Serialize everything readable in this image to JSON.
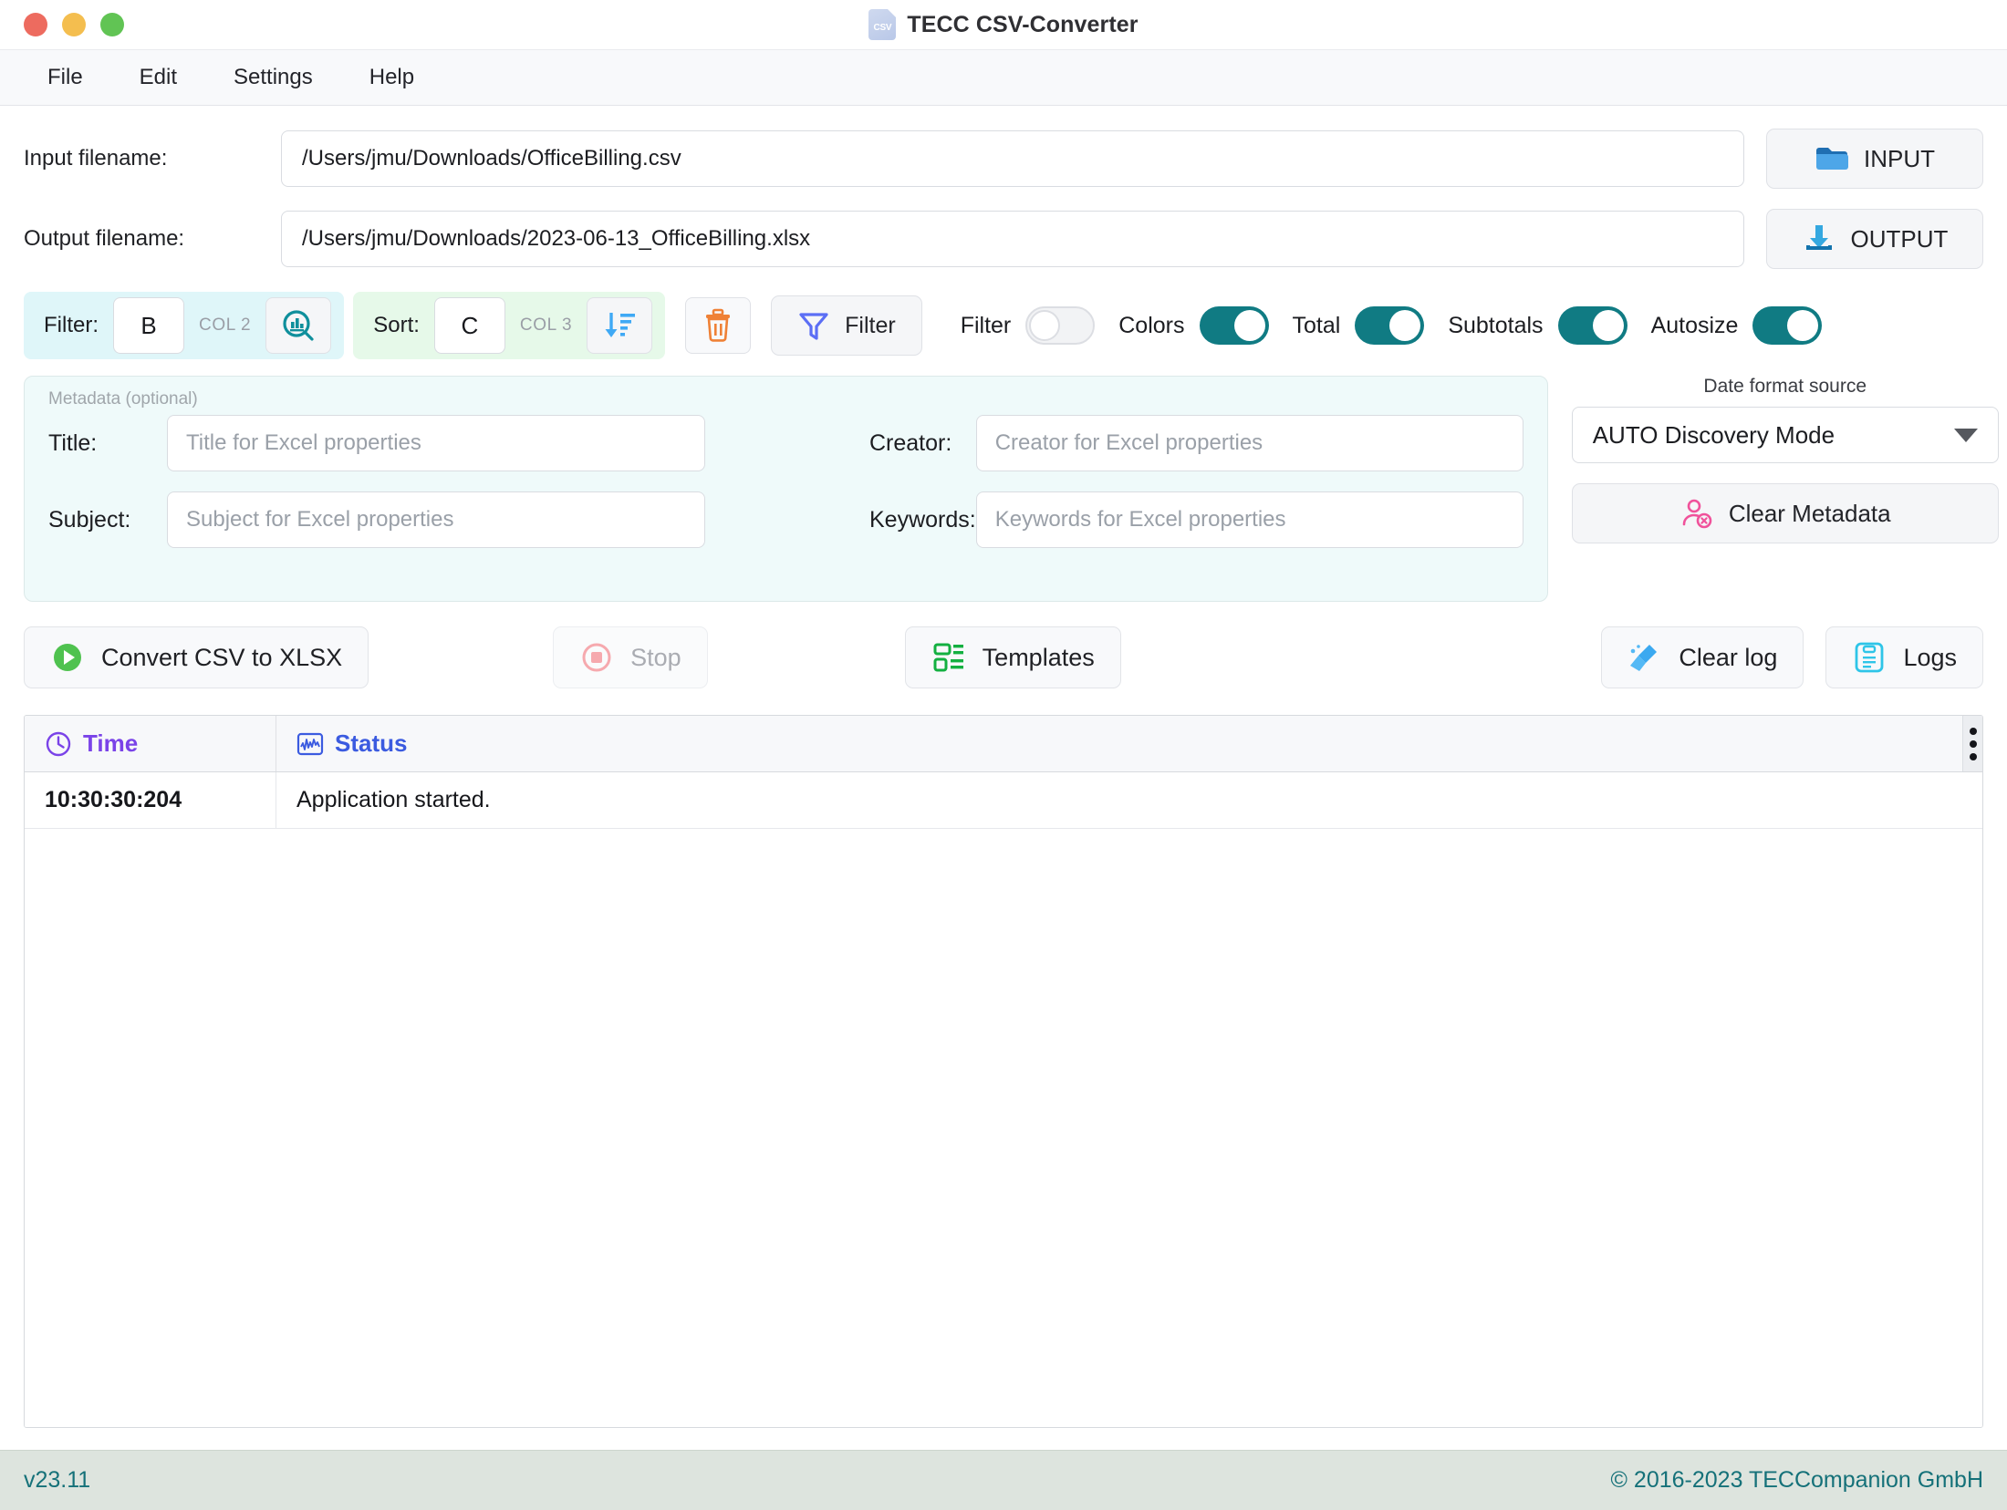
{
  "window": {
    "title": "TECC CSV-Converter",
    "app_icon": "csv-file-icon",
    "icon_label": "CSV",
    "controls": [
      "close",
      "minimize",
      "maximize"
    ]
  },
  "menubar": {
    "items": [
      {
        "label": "File"
      },
      {
        "label": "Edit"
      },
      {
        "label": "Settings"
      },
      {
        "label": "Help"
      }
    ]
  },
  "files": {
    "input_label": "Input filename:",
    "input_value": "/Users/jmu/Downloads/OfficeBilling.csv",
    "input_button": "INPUT",
    "output_label": "Output filename:",
    "output_value": "/Users/jmu/Downloads/2023-06-13_OfficeBilling.xlsx",
    "output_button": "OUTPUT"
  },
  "toolbar": {
    "filter_label": "Filter:",
    "filter_column": "B",
    "filter_column_hint": "COL 2",
    "filter_preview_icon": "chart-search-icon",
    "sort_label": "Sort:",
    "sort_column": "C",
    "sort_column_hint": "COL 3",
    "sort_icon": "sort-descending-icon",
    "delete_icon": "trash-icon",
    "filter_button": "Filter",
    "filter_button_icon": "funnel-icon",
    "switches": [
      {
        "label": "Filter",
        "state": "off"
      },
      {
        "label": "Colors",
        "state": "on"
      },
      {
        "label": "Total",
        "state": "on"
      },
      {
        "label": "Subtotals",
        "state": "on"
      },
      {
        "label": "Autosize",
        "state": "on"
      }
    ],
    "accent_on": "#107b83"
  },
  "metadata": {
    "group_title": "Metadata (optional)",
    "fields": [
      {
        "label": "Title:",
        "value": "",
        "placeholder": "Title for Excel properties"
      },
      {
        "label": "Creator:",
        "value": "",
        "placeholder": "Creator for Excel properties"
      },
      {
        "label": "Subject:",
        "value": "",
        "placeholder": "Subject for Excel properties"
      },
      {
        "label": "Keywords:",
        "value": "",
        "placeholder": "Keywords for Excel properties"
      }
    ]
  },
  "dateformat": {
    "label": "Date format source",
    "selected": "AUTO Discovery Mode",
    "clear_button": "Clear Metadata",
    "clear_icon": "user-remove-icon"
  },
  "actions": {
    "convert": "Convert CSV to XLSX",
    "convert_icon": "play-icon",
    "stop": "Stop",
    "stop_icon": "stop-icon",
    "stop_disabled": true,
    "templates": "Templates",
    "templates_icon": "templates-icon",
    "clear_log": "Clear log",
    "clear_log_icon": "broom-icon",
    "logs": "Logs",
    "logs_icon": "clipboard-icon"
  },
  "log": {
    "columns": [
      {
        "label": "Time",
        "icon": "clock-icon",
        "color": "#7a43e8"
      },
      {
        "label": "Status",
        "icon": "waveform-icon",
        "color": "#3b5be0"
      }
    ],
    "rows": [
      {
        "time": "10:30:30:204",
        "status": "Application started."
      }
    ],
    "menu_icon": "more-vertical-icon"
  },
  "footer": {
    "version": "v23.11",
    "copyright": "© 2016-2023 TECCompanion GmbH"
  }
}
